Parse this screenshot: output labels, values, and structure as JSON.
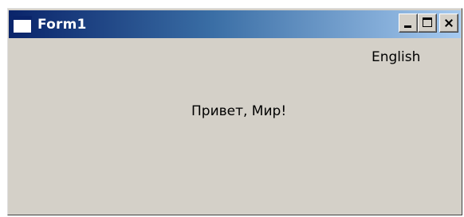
{
  "window": {
    "title": "Form1",
    "caption_buttons": {
      "minimize_icon": "minimize-icon",
      "maximize_icon": "maximize-icon",
      "close_icon": "close-icon"
    }
  },
  "content": {
    "language_toggle": "English",
    "greeting": "Привет, Мир!"
  },
  "colors": {
    "titlebar_start": "#0a246a",
    "titlebar_end": "#a6caf0",
    "window_bg": "#d4d0c8"
  }
}
